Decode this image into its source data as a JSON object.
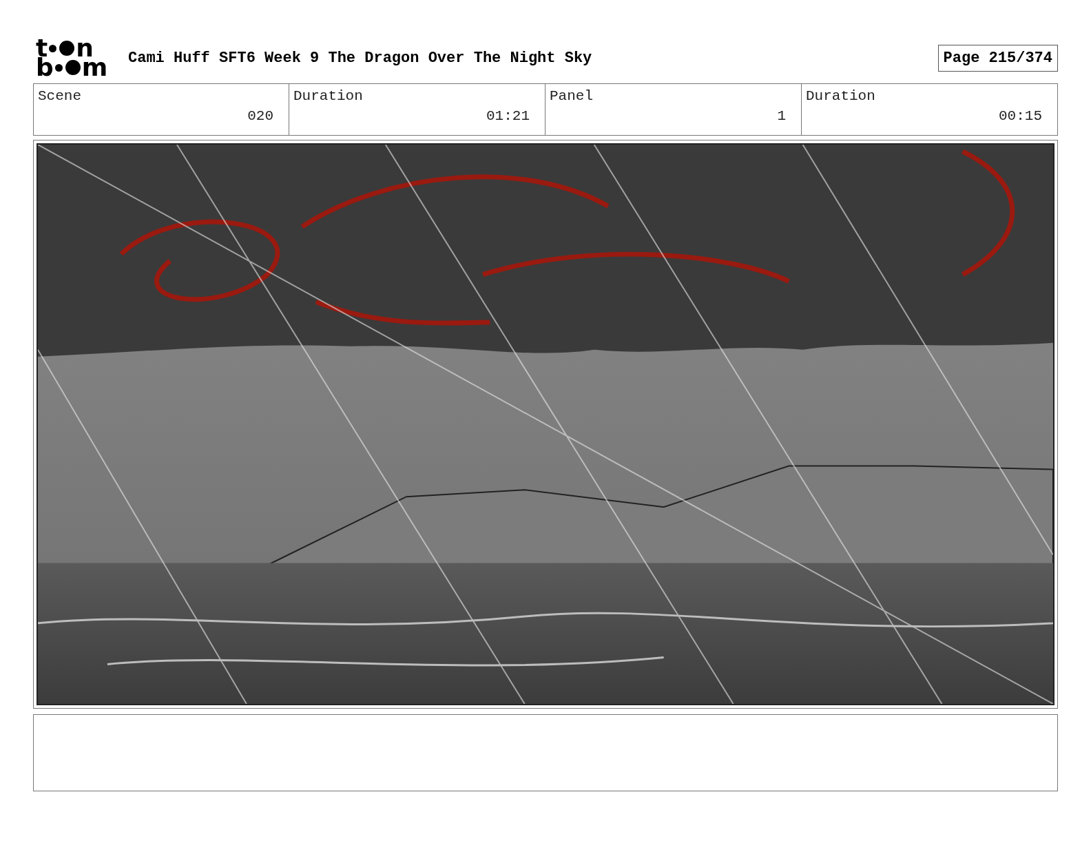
{
  "header": {
    "logo": {
      "letters": [
        "t",
        "n",
        "b",
        "m"
      ]
    },
    "title": "Cami Huff SFT6 Week 9 The Dragon Over The Night Sky",
    "page": "Page 215/374"
  },
  "info": [
    {
      "label": "Scene",
      "value": "020"
    },
    {
      "label": "Duration",
      "value": "01:21"
    },
    {
      "label": "Panel",
      "value": "1"
    },
    {
      "label": "Duration",
      "value": "00:15"
    }
  ]
}
